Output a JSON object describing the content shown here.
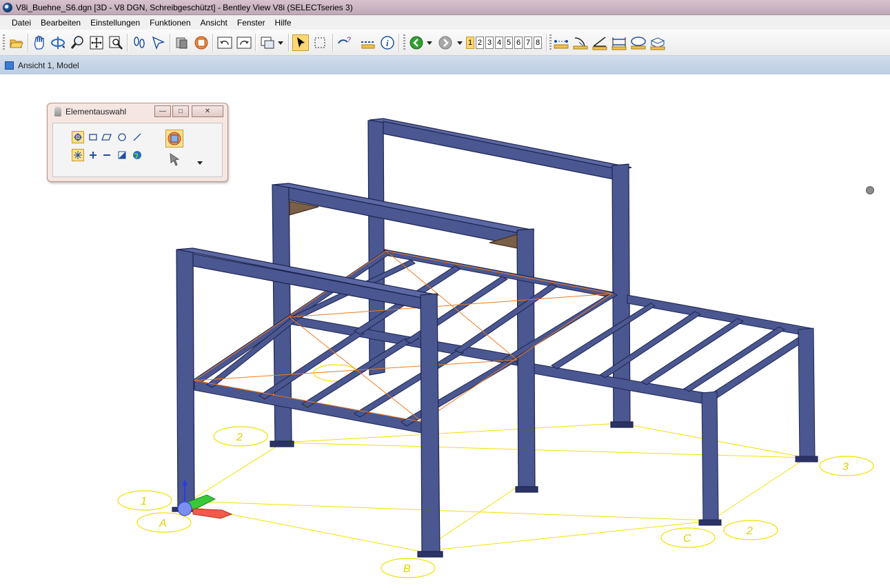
{
  "window": {
    "title": "V8i_Buehne_S6.dgn [3D - V8 DGN, Schreibgeschützt] - Bentley View V8i (SELECTseries 3)"
  },
  "menu": [
    "Datei",
    "Bearbeiten",
    "Einstellungen",
    "Funktionen",
    "Ansicht",
    "Fenster",
    "Hilfe"
  ],
  "toolbar": {
    "tools": [
      "open-icon",
      "pan-hand-icon",
      "rotate-view-icon",
      "zoom-icon",
      "fit-view-icon",
      "window-area-icon",
      "walk-icon",
      "select-arrow-icon",
      "saved-view-icon",
      "display-style-icon",
      "undo-view-icon",
      "redo-view-icon",
      "view-window-icon",
      "element-selection-icon",
      "fence-icon",
      "element-info-icon",
      "measure-icon",
      "info-icon",
      "back-green-icon",
      "forward-gray-icon",
      "measure-distance-icon",
      "measure-radius-icon",
      "measure-angle-icon",
      "measure-length-icon",
      "measure-area-icon",
      "measure-volume-icon"
    ],
    "view_numbers": [
      "1",
      "2",
      "3",
      "4",
      "5",
      "6",
      "7",
      "8"
    ],
    "active_view": "1"
  },
  "view": {
    "title": "Ansicht 1, Model"
  },
  "panel": {
    "title": "Elementauswahl",
    "minimize": "—",
    "restore": "□",
    "close": "✕"
  },
  "grid_labels": {
    "one": "1",
    "two_left": "2",
    "two_right": "2",
    "three": "3",
    "a": "A",
    "b": "B",
    "c": "C"
  },
  "colors": {
    "steel": "#4a5790",
    "steel_dark": "#1d2450",
    "grid": "#f0e000",
    "bracing": "#f07a20"
  }
}
